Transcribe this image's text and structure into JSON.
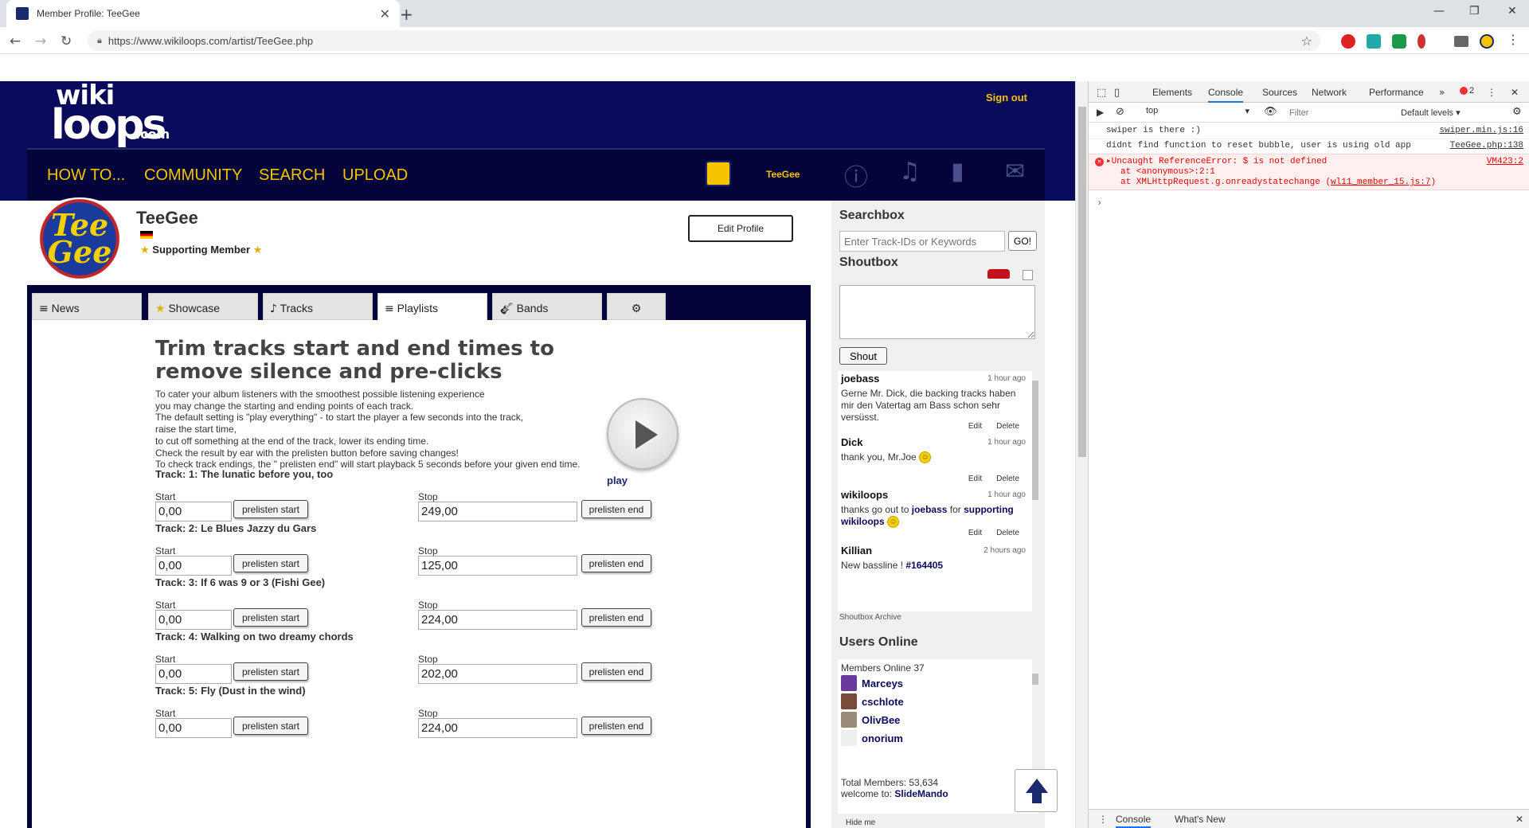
{
  "browser": {
    "tab_title": "Member Profile: TeeGee",
    "url": "https://www.wikiloops.com/artist/TeeGee.php"
  },
  "site": {
    "logo": {
      "wiki": "wiki",
      "loops": "loops",
      "com": ".com"
    },
    "sign_out": "Sign out",
    "nav": {
      "howto": "HOW TO...",
      "community": "COMMUNITY",
      "search": "SEARCH",
      "upload": "UPLOAD"
    },
    "nav_user": "TeeGee"
  },
  "profile": {
    "avatar_text": "Tee Gee",
    "name": "TeeGee",
    "membership": "Supporting Member",
    "edit_profile": "Edit Profile"
  },
  "tabs": {
    "news": "News",
    "showcase": "Showcase",
    "tracks": "Tracks",
    "playlists": "Playlists",
    "bands": "Bands"
  },
  "trim": {
    "title": "Trim tracks start and end times to remove silence and pre-clicks",
    "lines": [
      "To cater your album listeners with the smoothest possible listening experience",
      "you may change the starting and ending points of each track.",
      "The default setting is \"play everything\" - to start the player a few seconds into the track,",
      "raise the start time,",
      "to cut off something at the end of the track, lower its ending time.",
      "Check the result by ear with the prelisten button before saving changes!",
      "To check track endings, the \" prelisten end\" will start playback 5 seconds before your given end time."
    ],
    "play_label": "play",
    "start_label": "Start",
    "stop_label": "Stop",
    "prelisten_start": "prelisten start",
    "prelisten_end": "prelisten end",
    "tracks": [
      {
        "name": "Track: 1: The lunatic before you, too",
        "start": "0,00",
        "stop": "249,00"
      },
      {
        "name": "Track: 2: Le Blues Jazzy du Gars",
        "start": "0,00",
        "stop": "125,00"
      },
      {
        "name": "Track: 3: If 6 was 9 or 3 (Fishi Gee)",
        "start": "0,00",
        "stop": "224,00"
      },
      {
        "name": "Track: 4: Walking on two dreamy chords",
        "start": "0,00",
        "stop": "202,00"
      },
      {
        "name": "Track: 5: Fly (Dust in the wind)",
        "start": "0,00",
        "stop": "224,00"
      }
    ]
  },
  "sidebar": {
    "searchbox_title": "Searchbox",
    "search_placeholder": "Enter Track-IDs or Keywords",
    "go": "GO!",
    "shoutbox_title": "Shoutbox",
    "shout_button": "Shout",
    "edit": "Edit",
    "delete": "Delete",
    "shouts": [
      {
        "user": "joebass",
        "time": "1 hour ago",
        "message": "Gerne Mr. Dick, die backing tracks haben mir den Vatertag am Bass schon sehr versüsst."
      },
      {
        "user": "Dick",
        "time": "1 hour ago",
        "message": "thank you, Mr.Joe"
      },
      {
        "user": "wikiloops",
        "time": "1 hour ago",
        "message_pre": "thanks go out to ",
        "message_user": "joebass",
        "message_mid": " for ",
        "message_bold": "supporting wikiloops"
      },
      {
        "user": "Killian",
        "time": "2 hours ago",
        "message_pre": "New bassline ! ",
        "message_bold": "#164405"
      }
    ],
    "shoutbox_archive": "Shoutbox Archive",
    "users_online_title": "Users Online",
    "members_online": "Members Online 37",
    "online_users": [
      "Marceys",
      "cschlote",
      "OlivBee",
      "onorium"
    ],
    "total_members": "Total Members: 53,634",
    "welcome_pre": "welcome to: ",
    "welcome_user": "SlideMando",
    "hide_me": "Hide me"
  },
  "devtools": {
    "tabs": {
      "elements": "Elements",
      "console": "Console",
      "sources": "Sources",
      "network": "Network",
      "performance": "Performance"
    },
    "error_count": "2",
    "context": "top",
    "filter_placeholder": "Filter",
    "levels": "Default levels",
    "logs": [
      {
        "text": "swiper is there :)",
        "source": "swiper.min.js:16"
      },
      {
        "text": "didnt find function to reset bubble, user is using old app",
        "source": "TeeGee.php:138"
      }
    ],
    "error": {
      "line1": "▸Uncaught ReferenceError: $ is not defined",
      "line2": "at <anonymous>:2:1",
      "line3_pre": "at XMLHttpRequest.g.onreadystatechange (",
      "line3_link": "wl11_member_15.js:7",
      "line3_post": ")",
      "source": "VM423:2"
    },
    "drawer": {
      "console": "Console",
      "whats_new": "What's New"
    }
  }
}
